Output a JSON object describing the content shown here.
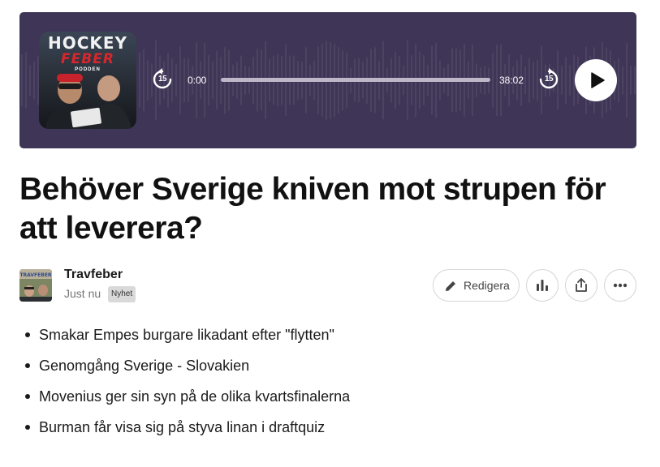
{
  "player": {
    "cover": {
      "title": "HOCKEY",
      "subtitle": "FEBER",
      "tag": "PODDEN"
    },
    "skip_back_label": "15",
    "skip_forward_label": "15",
    "current_time": "0:00",
    "duration": "38:02",
    "progress": 0,
    "background_color": "#3f3556"
  },
  "post": {
    "title": "Behöver Sverige kniven mot strupen för att leverera?",
    "author": "Travfeber",
    "date": "Just nu",
    "badge": "Nyhet",
    "edit_label": "Redigera",
    "bullets": [
      "Smakar Empes burgare likadant efter \"flytten\"",
      "Genomgång Sverige - Slovakien",
      "Movenius ger sin syn på de olika kvartsfinalerna",
      "Burman får visa sig på styva linan i draftquiz"
    ]
  },
  "icons": {
    "skip_back": "rewind-15-icon",
    "skip_forward": "forward-15-icon",
    "play": "play-icon",
    "edit": "pencil-icon",
    "stats": "bar-chart-icon",
    "share": "share-icon",
    "more": "more-icon"
  }
}
